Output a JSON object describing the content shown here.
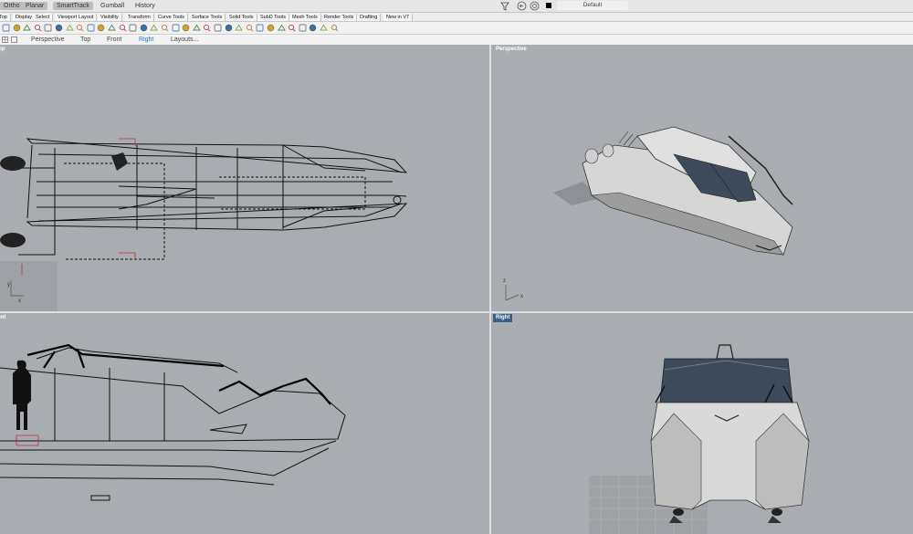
{
  "statusbar": {
    "buttons": [
      {
        "label": "Ortho",
        "active": true
      },
      {
        "label": "Planar",
        "active": true
      },
      {
        "label": "SmartTrack",
        "active": true
      },
      {
        "label": "Gumball",
        "active": false
      },
      {
        "label": "History",
        "active": false
      }
    ],
    "layer": "Default"
  },
  "toolbar_tabs": [
    "Top",
    "Display",
    "Select",
    "Viewport Layout",
    "Visibility",
    "Transform",
    "Curve Tools",
    "Surface Tools",
    "Solid Tools",
    "SubD Tools",
    "Mesh Tools",
    "Render Tools",
    "Drafting",
    "New in V7"
  ],
  "icons": [
    "new-icon",
    "open-icon",
    "save-icon",
    "print-icon",
    "cut-icon",
    "copy-icon",
    "paste-icon",
    "undo-icon",
    "redo-icon",
    "pan-icon",
    "rotate-view-icon",
    "zoom-icon",
    "zoom-window-icon",
    "zoom-extents-icon",
    "zoom-selected-icon",
    "named-view-icon",
    "grid-snap-icon",
    "osnap-icon",
    "select-icon",
    "properties-icon",
    "render-preview-icon",
    "lights-icon",
    "render-icon",
    "sun-icon",
    "material-icon",
    "layer-icon",
    "environment-icon",
    "wireframe-icon",
    "shaded-icon",
    "ghosted-icon",
    "rendered-icon",
    "help-icon"
  ],
  "viewport_tabs": [
    "Perspective",
    "Top",
    "Front",
    "Right",
    "Layouts..."
  ],
  "viewport_tab_active": "Right",
  "viewports": {
    "top": {
      "label": "Top"
    },
    "perspective": {
      "label": "Perspective"
    },
    "front": {
      "label": "Front"
    },
    "right": {
      "label": "Right"
    }
  },
  "axis_labels": {
    "x": "x",
    "y": "y",
    "z": "z"
  }
}
